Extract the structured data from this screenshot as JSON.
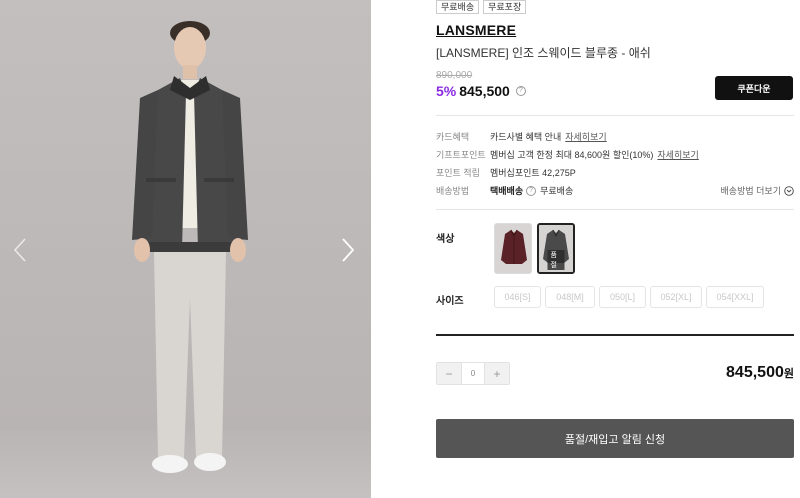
{
  "badges": [
    "무료배송",
    "무료포장"
  ],
  "brand": "LANSMERE",
  "product_name": "[LANSMERE] 인조 스웨이드 블루종 - 애쉬",
  "price": {
    "original": "890,000",
    "discount": "5%",
    "sale": "845,500",
    "help_icon": "question-icon"
  },
  "coupon_button": "쿠폰다운",
  "info": {
    "card": {
      "label": "카드혜택",
      "value": "카드사별 혜택 안내",
      "link": "자세히보기"
    },
    "gift_point": {
      "label": "기프트포인트",
      "value": "멤버십 고객 한정 최대 84,600원 할인(10%)",
      "link": "자세히보기"
    },
    "point": {
      "label": "포인트 적립",
      "value": "멤버십포인트 42,275P"
    },
    "shipping": {
      "label": "배송방법",
      "method": "택배배송",
      "fee": "무료배송",
      "more": "배송방법 더보기"
    }
  },
  "options": {
    "color_label": "색상",
    "colors": [
      {
        "name": "burgundy",
        "swatch": "#5a2226"
      },
      {
        "name": "ash",
        "swatch": "#4a4a4a",
        "tag": "품절"
      }
    ],
    "size_label": "사이즈",
    "sizes": [
      "046[S]",
      "048[M]",
      "050[L]",
      "052[XL]",
      "054[XXL]"
    ]
  },
  "quantity": {
    "minus": "−",
    "value": "0",
    "plus": "+"
  },
  "total": {
    "amount": "845,500",
    "unit": "원"
  },
  "notify_button": "품절/재입고 알림 신청",
  "colors": {
    "discount": "#8a2be2",
    "coupon_bg": "#111111",
    "notify_bg": "#555555"
  }
}
